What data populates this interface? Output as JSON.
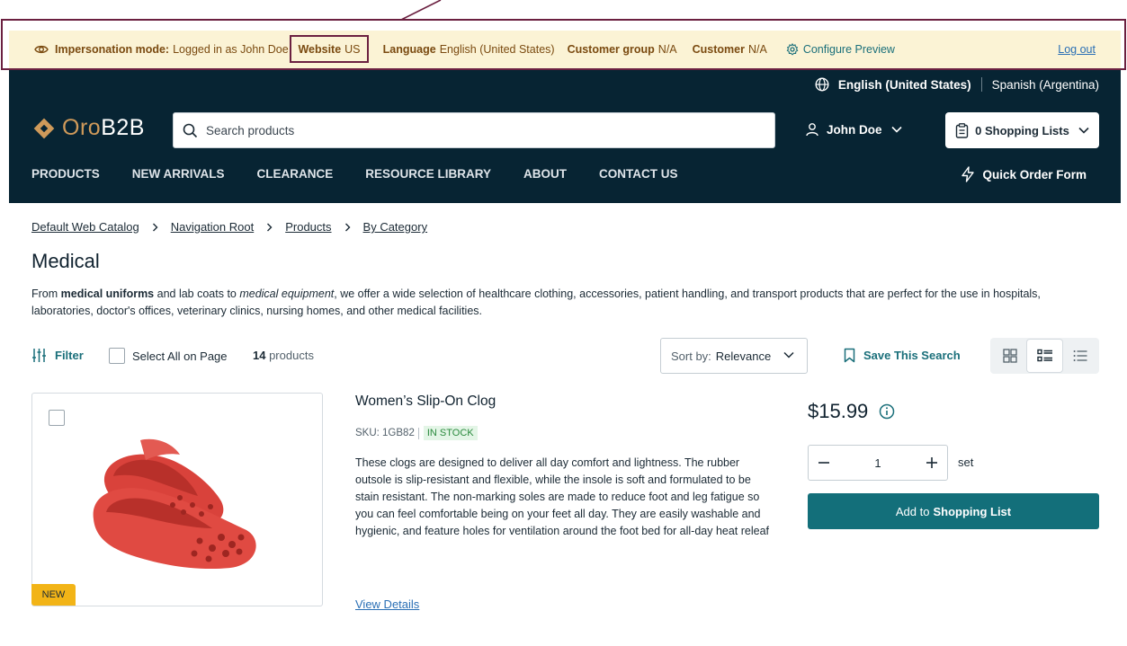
{
  "impersonation": {
    "mode_label": "Impersonation mode:",
    "logged_in_text": "Logged in as John Doe",
    "website_label": "Website",
    "website_value": "US",
    "language_label": "Language",
    "language_value": "English (United States)",
    "customer_group_label": "Customer group",
    "customer_group_value": "N/A",
    "customer_label": "Customer",
    "customer_value": "N/A",
    "configure_preview": "Configure Preview",
    "logout": "Log out"
  },
  "header": {
    "languages": {
      "current": "English (United States)",
      "other": "Spanish (Argentina)"
    },
    "logo": {
      "part1": "Oro",
      "part2": "B2B"
    },
    "search_placeholder": "Search products",
    "user_name": "John Doe",
    "shopping_lists": "0 Shopping Lists",
    "nav": [
      "PRODUCTS",
      "NEW ARRIVALS",
      "CLEARANCE",
      "RESOURCE LIBRARY",
      "ABOUT",
      "CONTACT US"
    ],
    "quick_order": "Quick Order Form"
  },
  "breadcrumbs": [
    "Default Web Catalog",
    "Navigation Root",
    "Products",
    "By Category"
  ],
  "page": {
    "title": "Medical",
    "desc_1": "From ",
    "desc_b1": "medical uniforms",
    "desc_2": " and lab coats to ",
    "desc_i1": "medical equipment",
    "desc_3": ", we offer a wide selection of healthcare clothing, accessories, patient handling, and transport products that are perfect for the use in hospitals, laboratories, doctor's offices, veterinary clinics, nursing homes, and other medical facilities."
  },
  "toolbar": {
    "filter": "Filter",
    "select_all": "Select All on Page",
    "count_number": "14",
    "count_label": " products",
    "sort_label": "Sort by:",
    "sort_value": "Relevance",
    "save_search": "Save This Search"
  },
  "product": {
    "name": "Women’s Slip-On Clog",
    "sku": "SKU: 1GB82",
    "stock": "IN STOCK",
    "description": "These clogs are designed to deliver all day comfort and lightness. The rubber outsole is slip-resistant and flexible, while the insole is soft and formulated to be stain resistant. The non-marking soles are made to reduce foot and leg fatigue so you can feel comfortable being on your feet all day. They are easily washable and hygienic, and feature holes for ventilation around the foot bed for all-day heat releaf",
    "view_details": "View Details",
    "badge": "NEW",
    "price": "$15.99",
    "quantity": "1",
    "unit": "set",
    "add_prefix": "Add to",
    "add_bold": "Shopping List"
  },
  "colors": {
    "header_bg": "#072433",
    "impersonation_bg": "#fbf3d5",
    "accent": "#136f7a",
    "annotation": "#6b2040",
    "badge": "#f2b417"
  }
}
